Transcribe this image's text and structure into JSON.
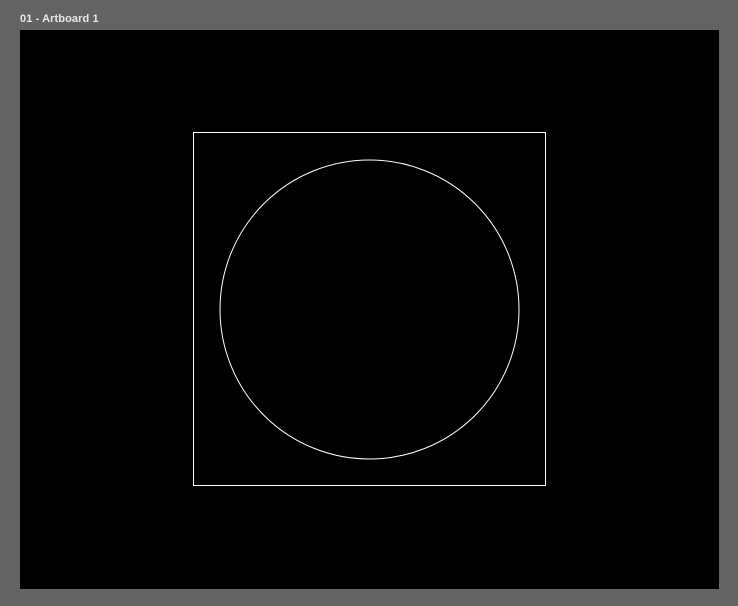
{
  "artboard": {
    "label": "01 - Artboard 1",
    "background_color": "#000000"
  },
  "workspace": {
    "background_color": "#636363"
  },
  "shapes": {
    "stroke_color": "#ffffff",
    "items": [
      "rectangle",
      "circle"
    ]
  }
}
